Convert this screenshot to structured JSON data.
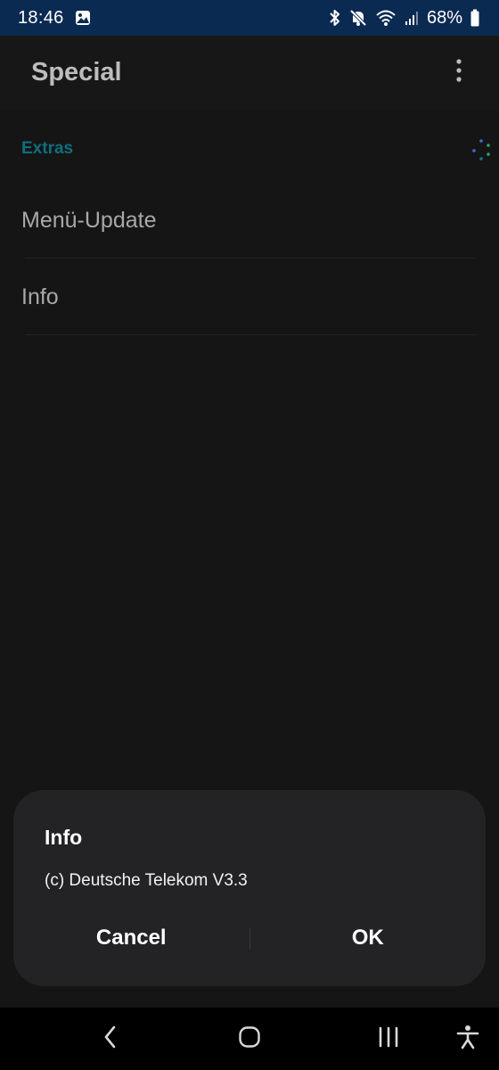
{
  "status_bar": {
    "time": "18:46",
    "battery": "68%",
    "icons": [
      "gallery-icon",
      "bluetooth-icon",
      "mute-icon",
      "wifi-icon",
      "signal-icon",
      "battery-icon"
    ]
  },
  "app_bar": {
    "title": "Special",
    "menu_icon": "more-vert-icon"
  },
  "content": {
    "section_header": "Extras",
    "items": [
      {
        "label": "Menü-Update"
      },
      {
        "label": "Info"
      }
    ]
  },
  "dialog": {
    "title": "Info",
    "message": "(c) Deutsche Telekom V3.3",
    "cancel_label": "Cancel",
    "ok_label": "OK"
  },
  "nav_bar": {
    "icons": [
      "back-icon",
      "home-icon",
      "recents-icon",
      "accessibility-icon"
    ]
  },
  "colors": {
    "status_bar": "#0b2a52",
    "background": "#151515",
    "accent": "#0f6e7d",
    "dialog": "#232326"
  }
}
